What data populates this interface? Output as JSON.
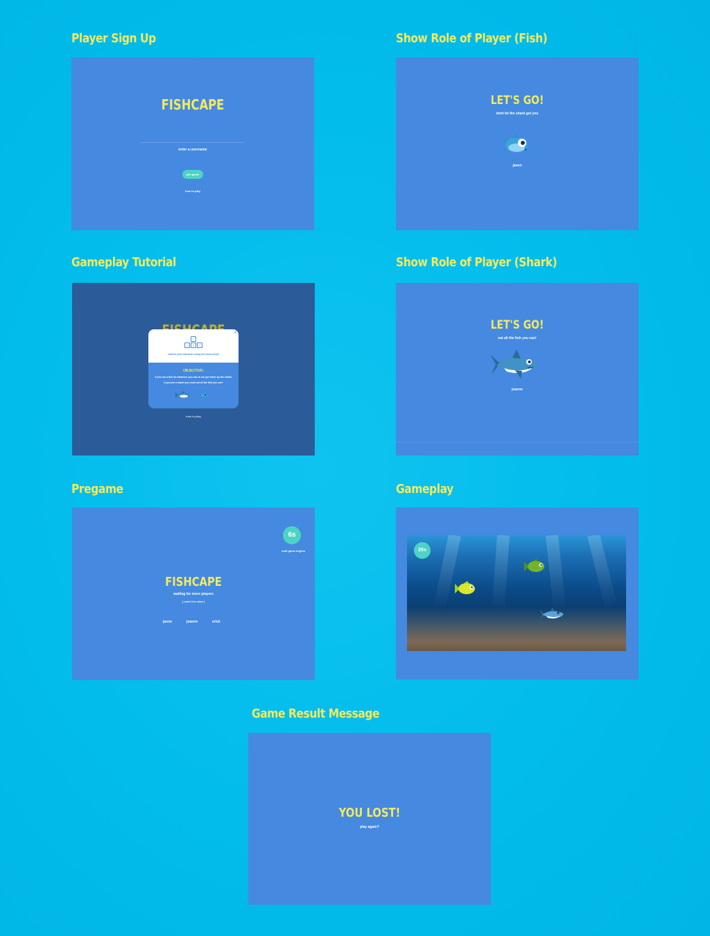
{
  "titles": {
    "signup": "Player Sign Up",
    "role_fish": "Show Role of Player (Fish)",
    "tutorial": "Gameplay Tutorial",
    "role_shark": "Show Role of Player (Shark)",
    "pregame": "Pregame",
    "gameplay": "Gameplay",
    "result": "Game Result Message"
  },
  "signup": {
    "game_title": "FISHCAPE",
    "username_label": "enter a username",
    "join_label": "join game",
    "how_to_play": "how to play"
  },
  "role_fish": {
    "heading": "LET'S GO!",
    "subtitle": "dont let the shark get you",
    "username": "jason"
  },
  "tutorial": {
    "game_title": "FISHCAPE",
    "keys": [
      "^",
      "<",
      "v",
      ">"
    ],
    "controls_text": "control your character using the arrow keys!",
    "objective_label": "OBJECTIVE:",
    "objective_fish": "If you are a fish do whatever you can to not get eaten by the shark!",
    "objective_shark": "If you are a shark you must eat all the fish you can!",
    "close_symbol": "x",
    "how_to_play": "how to play"
  },
  "role_shark": {
    "heading": "LET'S GO!",
    "subtitle": "eat all the fish you can!",
    "username": "joanne"
  },
  "pregame": {
    "timer": "6s",
    "timer_caption": "until game begins",
    "game_title": "FISHCAPE",
    "waiting_text": "waiting for more players",
    "need_text": "( need 3 to start )",
    "players": [
      "jason",
      "joanne",
      "erick"
    ]
  },
  "gameplay": {
    "timer": "25s"
  },
  "result": {
    "message": "YOU LOST!",
    "play_again": "play again?"
  },
  "colors": {
    "background": "#02bcec",
    "screen": "#4589e0",
    "title_yellow": "#f4ea5c",
    "accent_teal": "#4dd3c4",
    "tutorial_dim": "#2b5c99"
  }
}
